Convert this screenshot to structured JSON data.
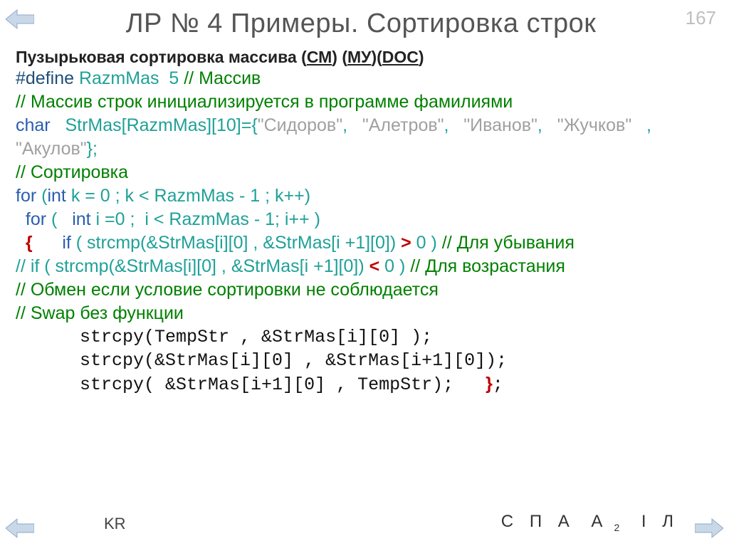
{
  "page_number": "167",
  "title_main": "ЛР № 4 Примеры.",
  "title_sub": " Сортировка строк",
  "heading_prefix": "Пузырьковая сортировка массива (",
  "heading_cm": "СМ",
  "heading_mid1": ") (",
  "heading_my": "МУ",
  "heading_mid2": ")(",
  "heading_doc": "DOC",
  "heading_suffix": ")",
  "l1_define": "#define",
  "l1_razm": " RazmMas  5 ",
  "l1_comment": "// Массив",
  "l2_comment": "// Массив строк инициализируется в программе фамилиями",
  "l3_char": "char",
  "l3_decl": "   StrMas[RazmMas][10]={",
  "l3_str1": "\"Сидоров\"",
  "l3_c1": ",   ",
  "l3_str2": "\"Алетров\"",
  "l3_c2": ",   ",
  "l3_str3": "\"Иванов\"",
  "l3_c3": ",   ",
  "l3_str4": "\"Жучков\"",
  "l3_c4": "   , ",
  "l4_str5": "\"Акулов\"",
  "l4_end": "};",
  "l5_comment": "// Сортировка",
  "l6_for": "for",
  "l6_p1": " (",
  "l6_int": "int",
  "l6_rest": " k = 0 ; k < RazmMas - 1 ; k++)",
  "l7_indent": "  ",
  "l7_for": "for",
  "l7_p1": " (   ",
  "l7_int": "int",
  "l7_rest": " i =0 ;  i < RazmMas - 1; i++ )",
  "l8_indent": "  ",
  "l8_brace": "{",
  "l8_gap": "      ",
  "l8_if": "if",
  "l8_cond": " ( strcmp(&StrMas[i][0] , &StrMas[i +1][0]) ",
  "l8_op": ">",
  "l8_zero": " 0 ) ",
  "l8_comment": "// Для убывания",
  "l9_prefix": "// ",
  "l9_if": "if",
  "l9_cond": " ( strcmp(&StrMas[i][0] , &StrMas[i +1][0]) ",
  "l9_op": "<",
  "l9_zero": " 0 ) ",
  "l9_comment": "// Для возрастания",
  "l10_comment": "// Обмен если условие сортировки не соблюдается",
  "l11_comment": "// Swap без функции",
  "l12": "      strcpy(TempStr , &StrMas[i][0] );",
  "l13": "      strcpy(&StrMas[i][0] , &StrMas[i+1][0]);",
  "l14_a": "      strcpy( &StrMas[i+1][0] , TempStr);   ",
  "l14_brace": "}",
  "l14_semi": ";",
  "footer_kr": "KR",
  "f_c": "С",
  "f_p": "П",
  "f_a": "А",
  "f_a2": "А",
  "f_a2s": "2",
  "f_i": "I",
  "f_l": "Л"
}
